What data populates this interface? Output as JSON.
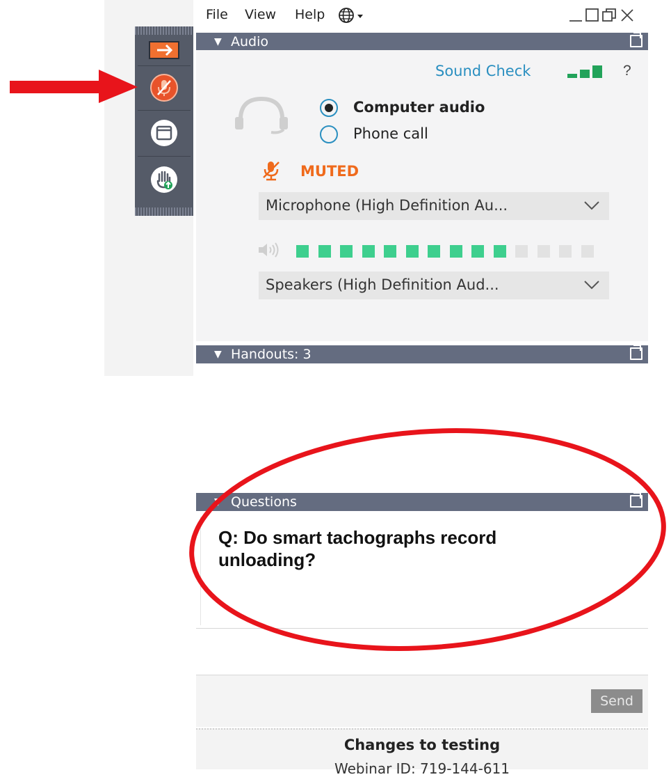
{
  "menu": {
    "file": "File",
    "view": "View",
    "help": "Help",
    "language_icon": "globe-icon"
  },
  "window_controls": {
    "minimize_icon": "minimize-icon",
    "maximize_icon": "maximize-icon",
    "restore_icon": "popout-icon",
    "close_icon": "close-icon"
  },
  "side_strip": {
    "buttons": [
      {
        "icon": "collapse-arrow-icon",
        "color": "#f07030"
      },
      {
        "icon": "microphone-muted-icon",
        "color": "#e8532a"
      },
      {
        "icon": "screen-icon",
        "color": "#ffffff"
      },
      {
        "icon": "raise-hand-icon",
        "color": "#22a35a"
      }
    ]
  },
  "audio": {
    "title": "Audio",
    "sound_check": "Sound Check",
    "help": "?",
    "options": [
      {
        "label": "Computer audio",
        "selected": true
      },
      {
        "label": "Phone call",
        "selected": false
      }
    ],
    "mute_status": "MUTED",
    "microphone": "Microphone (High Definition Au...",
    "speakers": "Speakers (High Definition Aud...",
    "speaker_level_segments_active": 10,
    "speaker_level_segments_total": 14,
    "colors": {
      "accent": "#2a8fc0",
      "muted": "#ef6a1c",
      "meter": "#3ecf8e"
    }
  },
  "handouts": {
    "title": "Handouts: 3"
  },
  "questions": {
    "title": "Questions",
    "text": "Q: Do smart tachographs record unloading?",
    "send": "Send"
  },
  "footer": {
    "title": "Changes to testing",
    "webinar_id": "Webinar ID: 719-144-611"
  },
  "annotations": {
    "arrow_color": "#e8141b",
    "ellipse_color": "#e8141b"
  }
}
